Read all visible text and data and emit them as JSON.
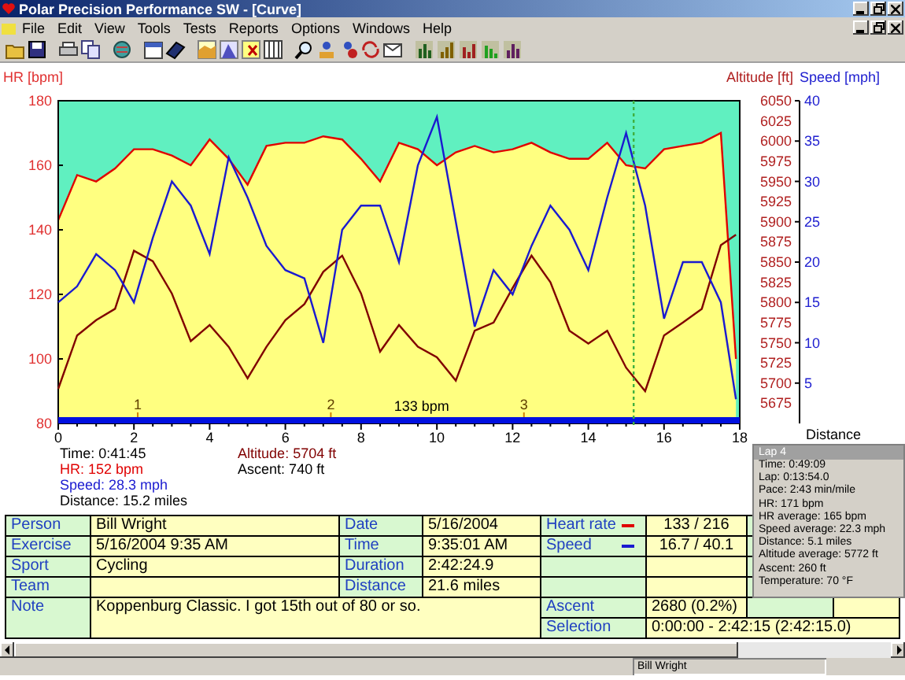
{
  "window": {
    "title": "Polar Precision Performance SW - [Curve]"
  },
  "menu": [
    "File",
    "Edit",
    "View",
    "Tools",
    "Tests",
    "Reports",
    "Options",
    "Windows",
    "Help"
  ],
  "chart": {
    "hr": {
      "chart_data": {
        "type": "line",
        "xlabel": "Distance",
        "ylabel": "HR [bpm]",
        "xlim": [
          0,
          18
        ],
        "ylim": [
          80,
          180
        ],
        "xticks": [
          0,
          2,
          4,
          6,
          8,
          10,
          12,
          14,
          16,
          18
        ],
        "yticks": [
          80,
          100,
          120,
          140,
          160,
          180
        ],
        "x": [
          0,
          0.5,
          1,
          1.5,
          2,
          2.5,
          3,
          3.5,
          4,
          4.5,
          5,
          5.5,
          6,
          6.5,
          7,
          7.5,
          8,
          8.5,
          9,
          9.5,
          10,
          10.5,
          11,
          11.5,
          12,
          12.5,
          13,
          13.5,
          14,
          14.5,
          15,
          15.5,
          16,
          16.5,
          17,
          17.5,
          17.9
        ],
        "series": [
          {
            "color": "#e00000",
            "values": [
              143,
              157,
              155,
              159,
              165,
              165,
              163,
              160,
              168,
              162,
              154,
              166,
              167,
              167,
              169,
              168,
              162,
              155,
              167,
              165,
              160,
              164,
              166,
              164,
              165,
              167,
              164,
              162,
              162,
              167,
              160,
              159,
              165,
              166,
              167,
              170,
              100
            ]
          }
        ],
        "annotations": [
          "1",
          "2",
          "3"
        ]
      },
      "average_label": "133 bpm",
      "cursor": {
        "level": 0.844
      }
    },
    "speed": {
      "chart_data": {
        "type": "line",
        "ylabel": "Speed [mph]",
        "xlim": [
          0,
          18
        ],
        "ylim": [
          0,
          40
        ],
        "yticks": [
          5,
          10,
          15,
          20,
          25,
          30,
          35,
          40
        ],
        "x": [
          0,
          0.5,
          1,
          1.5,
          2,
          2.5,
          3,
          3.5,
          4,
          4.5,
          5,
          5.5,
          6,
          6.5,
          7,
          7.5,
          8,
          8.5,
          9,
          9.5,
          10,
          10.5,
          11,
          11.5,
          12,
          12.5,
          13,
          13.5,
          14,
          14.5,
          15,
          15.5,
          16,
          16.5,
          17,
          17.5,
          17.9
        ],
        "series": [
          {
            "color": "#1a1ad0",
            "values": [
              15,
              17,
              21,
              19,
              15,
              23,
              30,
              27,
              21,
              33,
              28,
              22,
              19,
              18,
              10,
              24,
              27,
              27,
              20,
              32,
              38,
              25,
              12,
              19,
              16,
              22,
              27,
              24,
              19,
              28,
              36,
              27,
              13,
              20,
              20,
              15,
              3
            ]
          }
        ]
      }
    },
    "altitude": {
      "chart_data": {
        "type": "line",
        "ylabel": "Altitude [ft]",
        "xlim": [
          0,
          18
        ],
        "ylim": [
          5650,
          6050
        ],
        "yticks": [
          5675,
          5700,
          5725,
          5750,
          5775,
          5800,
          5825,
          5850,
          5875,
          5900,
          5925,
          5950,
          5975,
          6000,
          6025,
          6050
        ],
        "x": [
          0,
          0.5,
          1,
          1.5,
          2,
          2.5,
          3,
          3.5,
          4,
          4.5,
          5,
          5.5,
          6,
          6.5,
          7,
          7.5,
          8,
          8.5,
          9,
          9.5,
          10,
          10.5,
          11,
          11.5,
          12,
          12.5,
          13,
          13.5,
          14,
          14.5,
          15,
          15.5,
          16,
          16.5,
          17,
          17.5,
          17.9
        ],
        "series": [
          {
            "color": "#800000",
            "values": [
              5693,
              5759,
              5778,
              5792,
              5864,
              5851,
              5811,
              5752,
              5772,
              5745,
              5706,
              5745,
              5778,
              5798,
              5838,
              5858,
              5811,
              5739,
              5772,
              5745,
              5732,
              5703,
              5765,
              5775,
              5818,
              5858,
              5825,
              5765,
              5749,
              5765,
              5719,
              5690,
              5759,
              5775,
              5792,
              5871,
              5884
            ]
          }
        ]
      }
    }
  },
  "readout": {
    "left": [
      {
        "text": "Time: 0:41:45",
        "color": "#000000"
      },
      {
        "text": "HR: 152 bpm",
        "color": "#e00000"
      },
      {
        "text": "Speed: 28.3 mph",
        "color": "#1a1ad0"
      },
      {
        "text": "Distance: 15.2 miles",
        "color": "#000000"
      }
    ],
    "right": [
      {
        "text": "Altitude: 5704 ft",
        "color": "#800000"
      },
      {
        "text": "Ascent: 740 ft",
        "color": "#000000"
      }
    ]
  },
  "lap_box": {
    "title": "Lap 4",
    "lines": [
      "Time: 0:49:09",
      "Lap: 0:13:54.0",
      "Pace: 2:43 min/mile",
      "HR: 171 bpm",
      "HR average: 165 bpm",
      "Speed average: 22.3 mph",
      "Distance: 5.1 miles",
      "Altitude average: 5772 ft",
      "Ascent: 260 ft",
      "Temperature: 70 °F"
    ]
  },
  "info": {
    "person": {
      "label": "Person",
      "value": "Bill Wright"
    },
    "exercise": {
      "label": "Exercise",
      "value": "5/16/2004 9:35 AM"
    },
    "sport": {
      "label": "Sport",
      "value": "Cycling"
    },
    "team": {
      "label": "Team"
    },
    "note": {
      "label": "Note",
      "value": "Koppenburg Classic. I got 15th out of 80 or so."
    },
    "date": {
      "label": "Date",
      "value": "5/16/2004"
    },
    "time": {
      "label": "Time",
      "value": "9:35:01 AM"
    },
    "duration": {
      "label": "Duration",
      "value": "2:42:24.9"
    },
    "distance": {
      "label": "Distance",
      "value": "21.6 miles"
    },
    "heart_rate": {
      "label": "Heart rate",
      "value": "133 / 216",
      "color": "#e00000"
    },
    "speed": {
      "label": "Speed",
      "value": "16.7 / 40.1",
      "color": "#1a1ad0"
    },
    "ascent": {
      "label": "Ascent",
      "value": "2680 (0.2%)"
    },
    "selection": {
      "label": "Selection",
      "value": "0:00:00 - 2:42:15 (2:42:15.0)"
    }
  },
  "status_bar": {
    "user": "Bill Wright"
  }
}
